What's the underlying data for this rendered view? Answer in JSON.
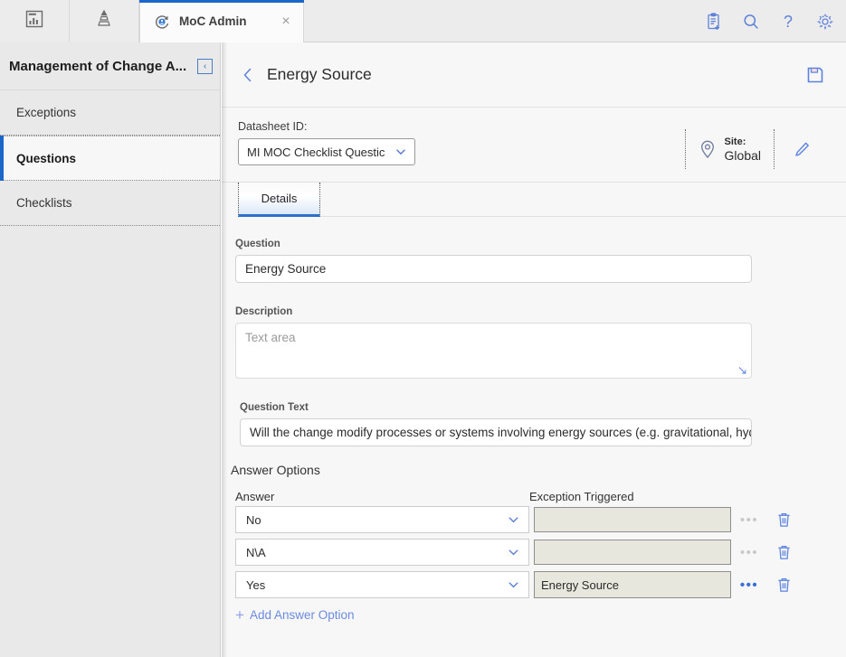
{
  "topbar": {
    "icon_tabs": [
      {
        "name": "dashboard-icon",
        "title": "Dashboards"
      },
      {
        "name": "hierarchy-icon",
        "title": "Hierarchy"
      }
    ],
    "app_tab": {
      "label": "MoC Admin",
      "icon": "moc-refresh-icon",
      "close_label": "×"
    },
    "right_icons": [
      {
        "name": "new-document-icon",
        "title": "New"
      },
      {
        "name": "search-icon",
        "title": "Search"
      },
      {
        "name": "help-icon",
        "title": "Help"
      },
      {
        "name": "gear-icon",
        "title": "Settings"
      }
    ],
    "accent_blue": "#1c66c9"
  },
  "sidebar": {
    "title": "Management of Change A...",
    "collapse_glyph": "‹",
    "items": [
      {
        "label": "Exceptions",
        "active": false
      },
      {
        "label": "Questions",
        "active": true
      },
      {
        "label": "Checklists",
        "active": false
      }
    ]
  },
  "page": {
    "back_glyph": "‹",
    "title": "Energy Source",
    "save_icon": "save-floppy-icon"
  },
  "datasheet": {
    "label": "Datasheet ID:",
    "selected": "MI MOC Checklist Questic",
    "options": [
      "MI MOC Checklist Question"
    ]
  },
  "site": {
    "label": "Site:",
    "value": "Global",
    "pin_icon": "location-pin-icon",
    "edit_icon": "pencil-icon"
  },
  "tabs": [
    {
      "label": "Details",
      "active": true
    }
  ],
  "form": {
    "question_label": "Question",
    "question_value": "Energy Source",
    "description_label": "Description",
    "description_value": "",
    "description_placeholder": "Text area",
    "question_text_label": "Question Text",
    "question_text_value": "Will the change modify processes or systems involving energy sources (e.g. gravitational, hydraulic, ele"
  },
  "answer_options": {
    "section_title": "Answer Options",
    "col_answer": "Answer",
    "col_exception": "Exception Triggered",
    "dots_glyph": "•••",
    "rows": [
      {
        "answer": "No",
        "exception": "",
        "exception_enabled": false,
        "dots_enabled": false
      },
      {
        "answer": "N\\A",
        "exception": "",
        "exception_enabled": false,
        "dots_enabled": false
      },
      {
        "answer": "Yes",
        "exception": "Energy Source",
        "exception_enabled": true,
        "dots_enabled": true
      }
    ],
    "add_label": "Add Answer Option",
    "add_glyph": "+"
  },
  "colors": {
    "accent": "#1c66c9",
    "link": "#6b8be0",
    "icon_blue": "#5b82e0",
    "sidebar_bg": "#e9e9e9",
    "content_bg": "#f7f7f7",
    "disabled_field": "#e7e7dd"
  }
}
